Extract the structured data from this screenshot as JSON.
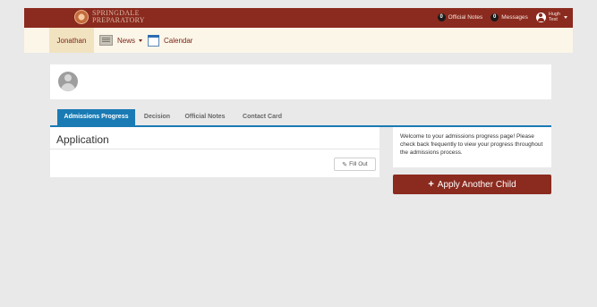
{
  "header": {
    "brand_line1": "SPRINGDALE",
    "brand_line2": "PREPARATORY",
    "official_notes_count": "0",
    "official_notes_label": "Official Notes",
    "messages_count": "0",
    "messages_label": "Messages",
    "user_first": "Hugh",
    "user_last": "Test"
  },
  "subnav": {
    "student": "Jonathan",
    "news": "News",
    "calendar": "Calendar"
  },
  "tabs": [
    {
      "label": "Admissions Progress",
      "active": true
    },
    {
      "label": "Decision",
      "active": false
    },
    {
      "label": "Official Notes",
      "active": false
    },
    {
      "label": "Contact Card",
      "active": false
    }
  ],
  "application": {
    "title": "Application",
    "fill_out_label": "Fill Out"
  },
  "info": {
    "message": "Welcome to your admissions progress page! Please check back frequently to view your progress throughout the admissions process."
  },
  "apply": {
    "label": "Apply Another Child"
  },
  "colors": {
    "brand": "#8b2a1e",
    "tab_active": "#1a7bb4",
    "subnav_bg": "#fbf6e8"
  }
}
